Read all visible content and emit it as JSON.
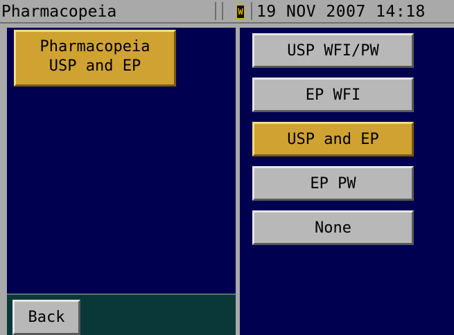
{
  "titlebar": {
    "title": "Pharmacopeia",
    "indicator": "W",
    "datetime": "19 NOV 2007 14:18"
  },
  "current_setting": {
    "line1": "Pharmacopeia",
    "line2": "USP and EP"
  },
  "options": [
    {
      "label": "USP WFI/PW",
      "selected": false
    },
    {
      "label": "EP WFI",
      "selected": false
    },
    {
      "label": "USP and EP",
      "selected": true
    },
    {
      "label": "EP PW",
      "selected": false
    },
    {
      "label": "None",
      "selected": false
    }
  ],
  "footer": {
    "back_label": "Back"
  },
  "colors": {
    "panel_bg": "#000050",
    "selected": "#d0a232",
    "button": "#b8b8b8",
    "footer_bg": "#0a3838"
  }
}
